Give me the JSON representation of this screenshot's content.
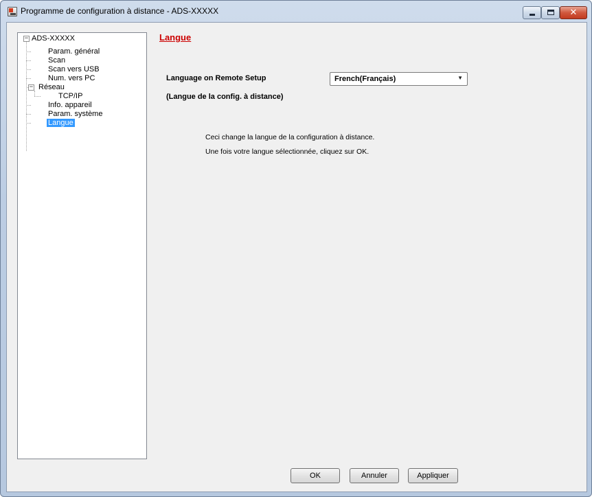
{
  "window": {
    "title": "Programme de configuration à distance - ADS-XXXXX",
    "close_glyph": "✕"
  },
  "tree": {
    "root": "ADS-XXXXX",
    "items": [
      {
        "label": "Param. général"
      },
      {
        "label": "Scan"
      },
      {
        "label": "Scan vers USB"
      },
      {
        "label": "Num. vers PC"
      },
      {
        "label": "Réseau"
      },
      {
        "label": "TCP/IP"
      },
      {
        "label": "Info. appareil"
      },
      {
        "label": "Param. système"
      },
      {
        "label": "Langue",
        "selected": true
      }
    ],
    "expander_glyph": "−"
  },
  "panel": {
    "title": "Langue",
    "language_label": "Language on Remote Setup",
    "language_label_fr": "(Langue de la config. à distance)",
    "language_value": "French(Français)",
    "dropdown_glyph": "▼",
    "info_line1": "Ceci change la langue de la configuration à distance.",
    "info_line2": "Une fois votre langue sélectionnée, cliquez sur OK."
  },
  "buttons": {
    "ok": "OK",
    "cancel": "Annuler",
    "apply": "Appliquer"
  },
  "colors": {
    "title_accent": "#cc0000",
    "selection": "#3399ff",
    "close_button": "#c23b20"
  },
  "icons": {
    "app": "scanner-app-icon",
    "minimize": "minimize-icon",
    "maximize": "maximize-icon",
    "close": "close-icon",
    "dropdown": "chevron-down-icon"
  }
}
